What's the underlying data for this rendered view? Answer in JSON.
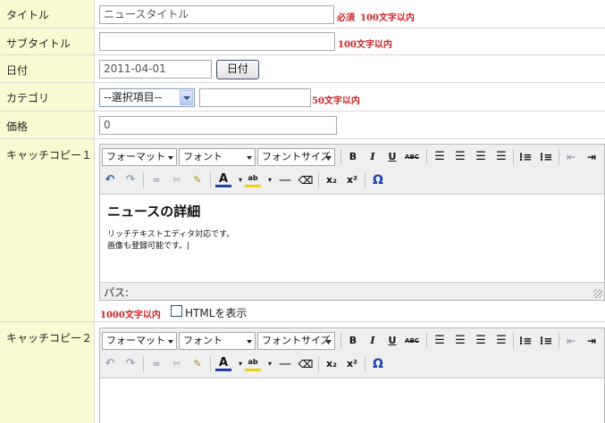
{
  "fields": {
    "title": {
      "label": "タイトル",
      "value": "ニュースタイトル",
      "required": "必須",
      "limit": "100文字以内"
    },
    "subtitle": {
      "label": "サブタイトル",
      "value": "",
      "limit": "100文字以内"
    },
    "date": {
      "label": "日付",
      "value": "2011-04-01",
      "button": "日付"
    },
    "category": {
      "label": "カテゴリ",
      "selected": "--選択項目--",
      "value": "",
      "limit": "50文字以内"
    },
    "price": {
      "label": "価格",
      "value": "0"
    }
  },
  "catch1": {
    "label": "キャッチコピー１",
    "toolbar": {
      "format": "フォーマット",
      "font": "フォント",
      "size": "フォントサイズ"
    },
    "content": {
      "heading": "ニュースの詳細",
      "line1": "リッチテキストエディタ対応です。",
      "line2": "画像も登録可能です。"
    },
    "path": "パス:",
    "limit": "1000文字以内",
    "html_toggle": "HTMLを表示"
  },
  "catch2": {
    "label": "キャッチコピー２",
    "toolbar": {
      "format": "フォーマット",
      "font": "フォント",
      "size": "フォントサイズ"
    }
  },
  "colors": {
    "label_bg": "#fafad2",
    "note": "#cc2222",
    "toolbar": "#efefef"
  }
}
